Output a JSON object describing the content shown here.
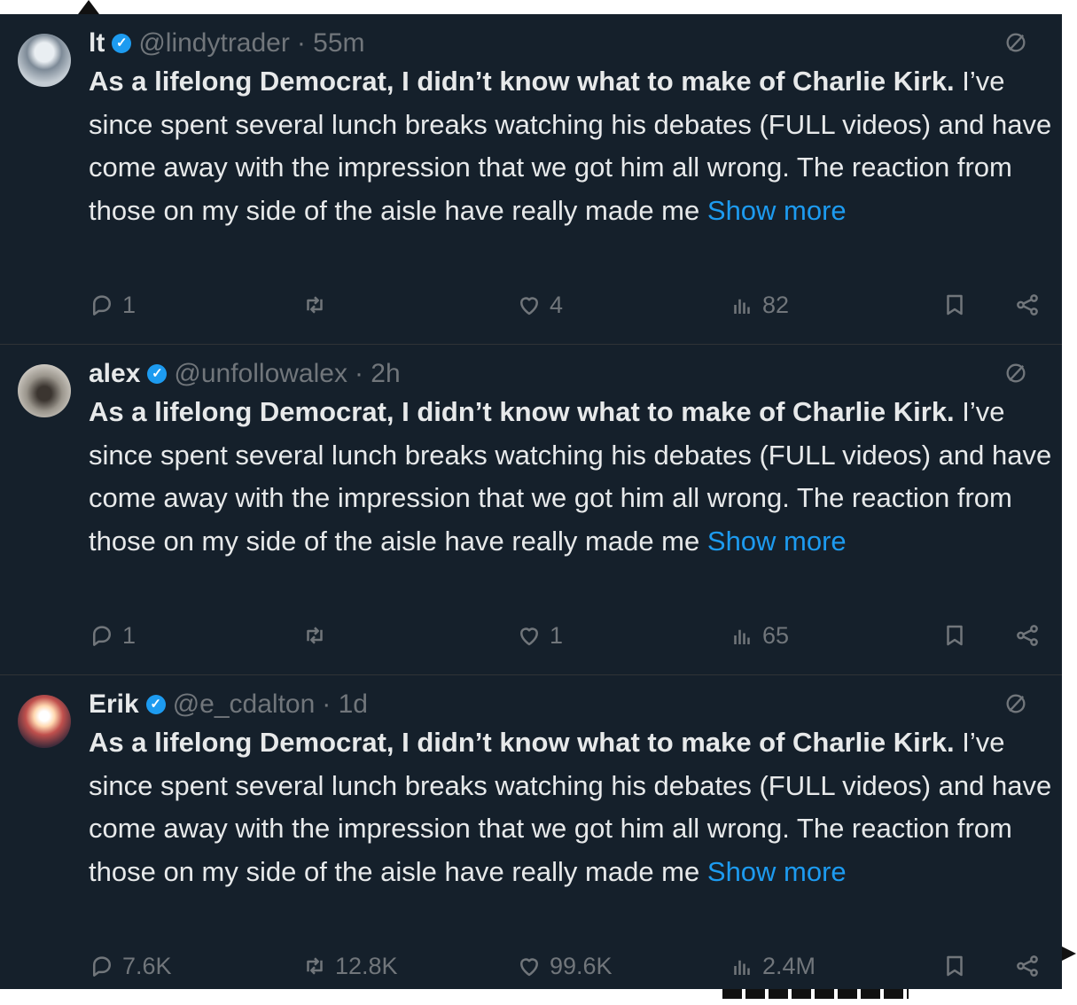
{
  "tweets": [
    {
      "name": "lt",
      "handle": "@lindytrader",
      "time": "· 55m",
      "lead": "As a lifelong Democrat, I didn’t know what to make of Charlie Kirk.",
      "rest": " I’ve since spent several lunch breaks watching his debates (FULL videos) and have come away with the impression that we got him all wrong. The reaction from those on my side of the aisle have really made me",
      "show_more": "Show more",
      "replies": "1",
      "reposts": "",
      "likes": "4",
      "views": "82"
    },
    {
      "name": "alex",
      "handle": "@unfollowalex",
      "time": "· 2h",
      "lead": "As a lifelong Democrat, I didn’t know what to make of Charlie Kirk.",
      "rest": " I’ve since spent several lunch breaks watching his debates (FULL videos) and have come away with the impression that we got him all wrong. The reaction from those on my side of the aisle have really made me",
      "show_more": "Show more",
      "replies": "1",
      "reposts": "",
      "likes": "1",
      "views": "65"
    },
    {
      "name": "Erik",
      "handle": "@e_cdalton",
      "time": "· 1d",
      "lead": "As a lifelong Democrat, I didn’t know what to make of Charlie Kirk.",
      "rest": " I’ve since spent several lunch breaks watching his debates (FULL videos) and have come away with the impression that we got him all wrong. The reaction from those on my side of the aisle have really made me",
      "show_more": "Show more",
      "replies": "7.6K",
      "reposts": "12.8K",
      "likes": "99.6K",
      "views": "2.4M"
    }
  ],
  "icons": {
    "verified": "verified-badge-icon",
    "grok": "grok-icon",
    "reply": "reply-icon",
    "repost": "repost-icon",
    "like": "like-icon",
    "views": "views-icon",
    "bookmark": "bookmark-icon",
    "share": "share-icon"
  },
  "colors": {
    "background": "#15202b",
    "text": "#e7e9ea",
    "muted": "#71767b",
    "accent": "#1d9bf0"
  }
}
